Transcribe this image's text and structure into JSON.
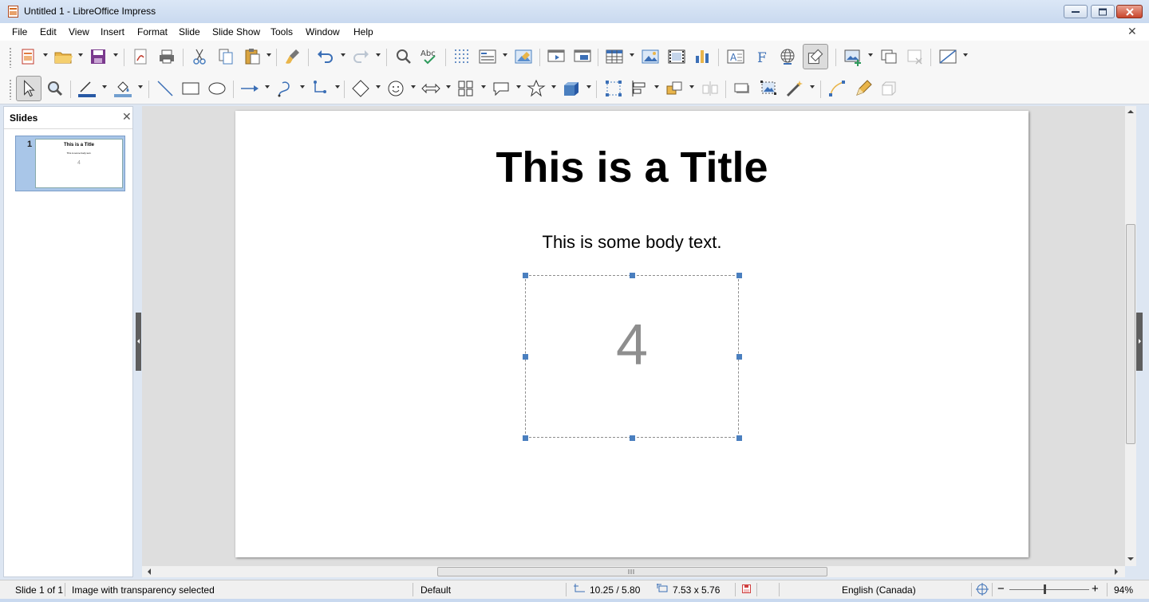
{
  "window": {
    "title": "Untitled 1 - LibreOffice Impress"
  },
  "menu": {
    "items": [
      {
        "label": "File"
      },
      {
        "label": "Edit"
      },
      {
        "label": "View"
      },
      {
        "label": "Insert"
      },
      {
        "label": "Format"
      },
      {
        "label": "Slide"
      },
      {
        "label": "Slide Show"
      },
      {
        "label": "Tools"
      },
      {
        "label": "Window"
      },
      {
        "label": "Help"
      }
    ],
    "close_glyph": "✕"
  },
  "slides_pane": {
    "title": "Slides",
    "close_glyph": "✕",
    "thumbnail": {
      "number": "1",
      "title": "This is a Title",
      "body": "This is some body text.",
      "image_text": "4"
    }
  },
  "slide": {
    "title": "This is a Title",
    "body": "This is some body text.",
    "image_text": "4"
  },
  "statusbar": {
    "slide_info": "Slide 1 of 1",
    "selection_info": "Image with transparency selected",
    "master": "Default",
    "position": "10.25 / 5.80",
    "size": "7.53 x 5.76",
    "language": "English (Canada)",
    "zoom_minus": "−",
    "zoom_plus": "+",
    "zoom_level": "94%"
  },
  "colors": {
    "accent": "#4a7fbf",
    "selection_border": "#8e8e8e"
  }
}
